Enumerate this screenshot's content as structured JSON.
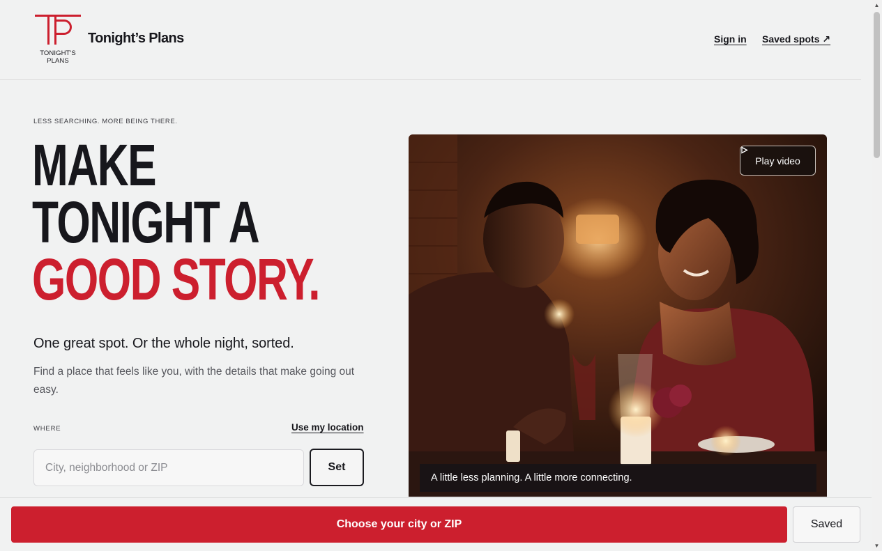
{
  "header": {
    "logo_monogram": "TP",
    "logo_caption_line1": "TONIGHT'S",
    "logo_caption_line2": "PLANS",
    "brand_name": "Tonight’s Plans",
    "nav": {
      "sign_in": "Sign in",
      "saved_spots": "Saved spots ↗"
    }
  },
  "hero": {
    "eyebrow": "LESS SEARCHING. MORE BEING THERE.",
    "headline_line1": "MAKE",
    "headline_line2": "TONIGHT A",
    "headline_line3": "GOOD STORY.",
    "subhead": "One great spot. Or the whole night, sorted.",
    "lede": "Find a place that feels like you, with the details that make going out easy.",
    "where_label": "WHERE",
    "use_location": "Use my location",
    "city_input": {
      "value": "",
      "placeholder": "City, neighborhood or ZIP"
    },
    "set_button": "Set"
  },
  "media": {
    "play_video_label": "Play video",
    "play_icon": "play-triangle-icon",
    "caption": "A little less planning. A little more connecting."
  },
  "bottom_bar": {
    "primary_cta": "Choose your city or ZIP",
    "saved": "Saved"
  },
  "colors": {
    "accent_red": "#cc1f2e",
    "ink": "#17171c",
    "background": "#f1f2f2"
  }
}
